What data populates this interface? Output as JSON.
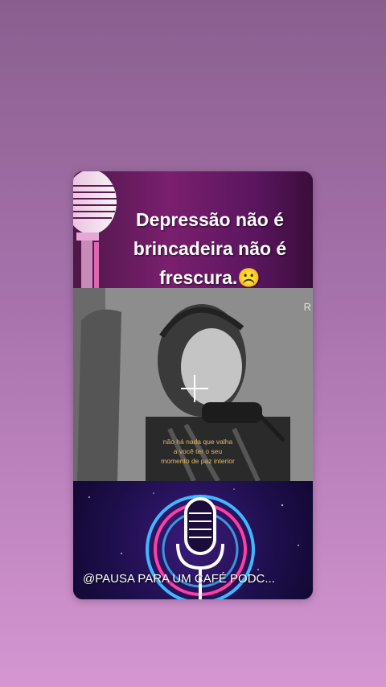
{
  "post": {
    "title_lines": [
      "Depressão não é",
      "brincadeira não é",
      "frescura.☹️"
    ],
    "video_corner_text": "R",
    "subtitle_lines": [
      "não há nada que valha",
      "a você ter o seu",
      "momento de paz interior"
    ],
    "channel_name": "@PAUSA PARA UM CAFÉ PODC..."
  },
  "colors": {
    "background_top": "#8a5f8f",
    "background_bottom": "#d596d2",
    "header_accent": "#7a1f6e",
    "neon_pink": "#ff3fa4",
    "neon_blue": "#3fb8ff",
    "subtitle_color": "#e6b860"
  },
  "icons": {
    "header_mic": "microphone-icon",
    "footer_mic": "neon-microphone-icon",
    "video_overlay": "crosshair-icon"
  }
}
